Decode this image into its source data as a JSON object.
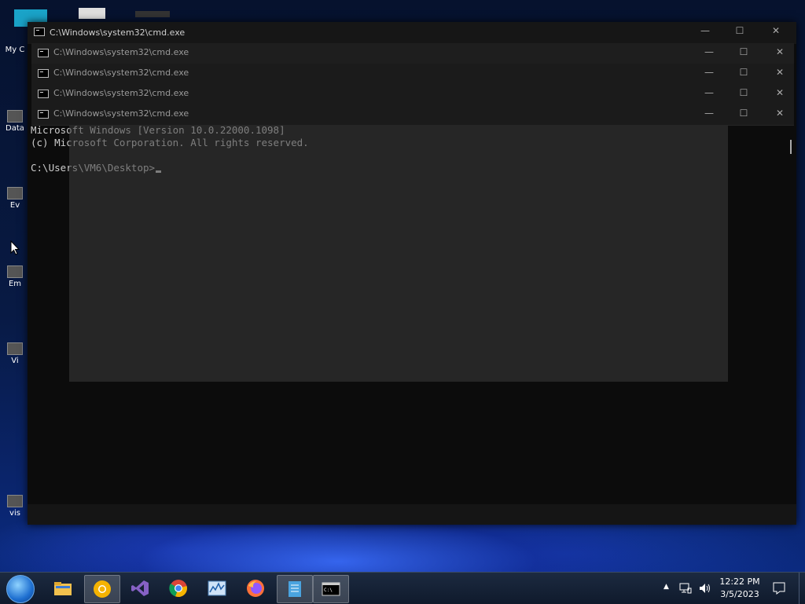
{
  "desktop": {
    "icons": [
      {
        "label": "My C",
        "icon": "computer-icon"
      },
      {
        "label": "Data",
        "icon": "database-icon"
      },
      {
        "label": "Ev",
        "icon": "event-icon"
      },
      {
        "label": "Em",
        "icon": "email-icon"
      },
      {
        "label": "Vi",
        "icon": "video-icon"
      },
      {
        "label": "vis",
        "icon": "visual-studio-icon"
      }
    ]
  },
  "windows": {
    "ghost_titles": [
      "C:\\Windows\\system32\\cmd.exe",
      "C:\\Windows\\system32\\cmd.exe",
      "C:\\Windows\\system32\\cmd.exe",
      "C:\\Windows\\system32\\cmd.exe"
    ],
    "main_title": "C:\\Windows\\system32\\cmd.exe",
    "controls": {
      "minimize": "—",
      "maximize": "☐",
      "close": "✕"
    }
  },
  "console": {
    "line1": "Microsoft Windows [Version 10.0.22000.1098]",
    "line2": "(c) Microsoft Corporation. All rights reserved.",
    "prompt": "C:\\Users\\VM6\\Desktop>"
  },
  "taskbar": {
    "apps": [
      {
        "name": "file-explorer",
        "icon": "folder-icon"
      },
      {
        "name": "chrome-canary",
        "icon": "chrome-yellow-icon"
      },
      {
        "name": "visual-studio",
        "icon": "visual-studio-icon"
      },
      {
        "name": "chrome",
        "icon": "chrome-icon"
      },
      {
        "name": "performance-monitor",
        "icon": "chart-icon"
      },
      {
        "name": "firefox",
        "icon": "firefox-icon"
      },
      {
        "name": "notepad",
        "icon": "notepad-icon"
      },
      {
        "name": "command-prompt",
        "icon": "cmd-icon"
      }
    ],
    "tray": {
      "time": "12:22 PM",
      "date": "3/5/2023"
    }
  }
}
